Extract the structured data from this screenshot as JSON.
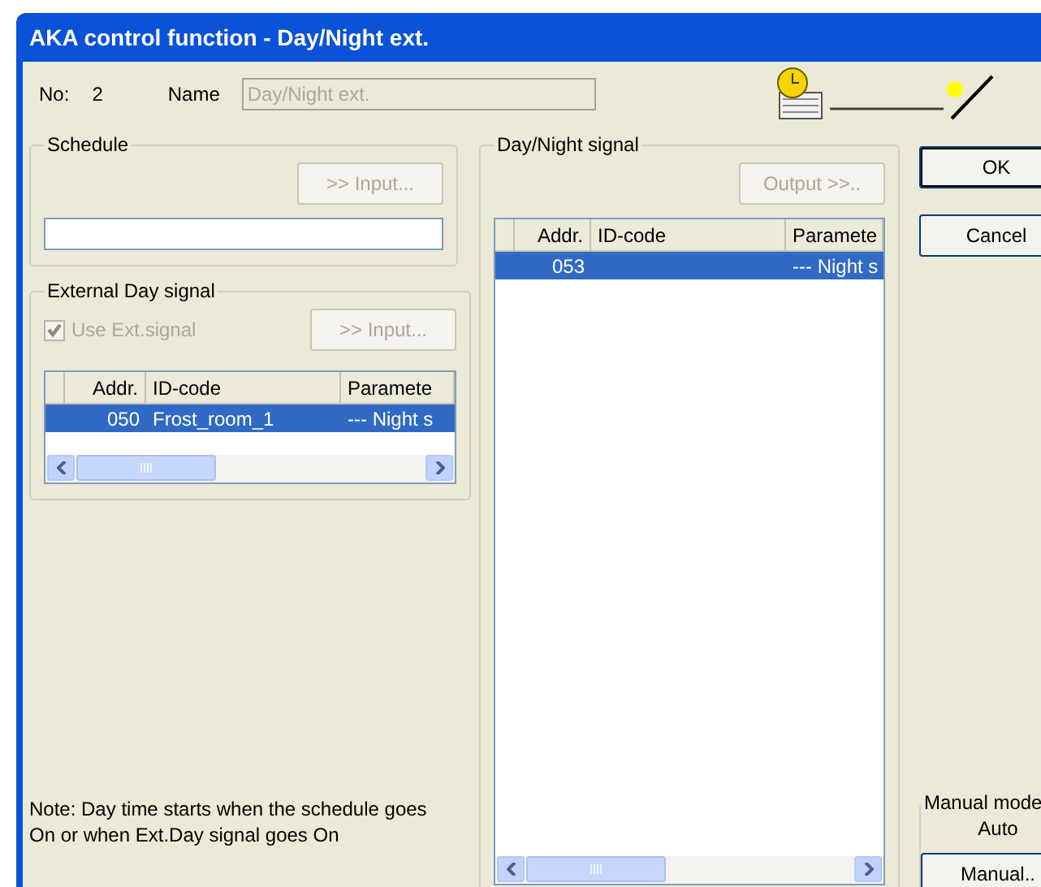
{
  "window": {
    "title": "AKA control function - Day/Night ext."
  },
  "header": {
    "no_label": "No:",
    "no_value": "2",
    "name_label": "Name",
    "name_value": "Day/Night ext."
  },
  "schedule": {
    "title": "Schedule",
    "input_button": {
      "label": ">> Input...",
      "disabled": true
    }
  },
  "external_day_signal": {
    "title": "External Day signal",
    "use_ext_signal": {
      "label": "Use Ext.signal",
      "checked": true,
      "disabled": true
    },
    "input_button": {
      "label": ">> Input...",
      "disabled": true
    },
    "table": {
      "columns": [
        "Addr.",
        "ID-code",
        "Paramete"
      ],
      "rows": [
        {
          "cells": [
            "050",
            "Frost_room_1",
            "--- Night s"
          ],
          "selected": true
        }
      ]
    }
  },
  "day_night_signal": {
    "title": "Day/Night signal",
    "output_button": {
      "label": "Output >>..",
      "disabled": true
    },
    "table": {
      "columns": [
        "Addr.",
        "ID-code",
        "Paramete"
      ],
      "rows": [
        {
          "cells": [
            "053",
            "",
            "--- Night s"
          ],
          "selected": true
        }
      ]
    }
  },
  "note": "Note: Day time starts when the schedule goes On or when Ext.Day signal goes On",
  "buttons": {
    "ok": "OK",
    "cancel": "Cancel"
  },
  "manual_mode": {
    "title": "Manual mode",
    "state": "Auto",
    "button": "Manual.."
  }
}
